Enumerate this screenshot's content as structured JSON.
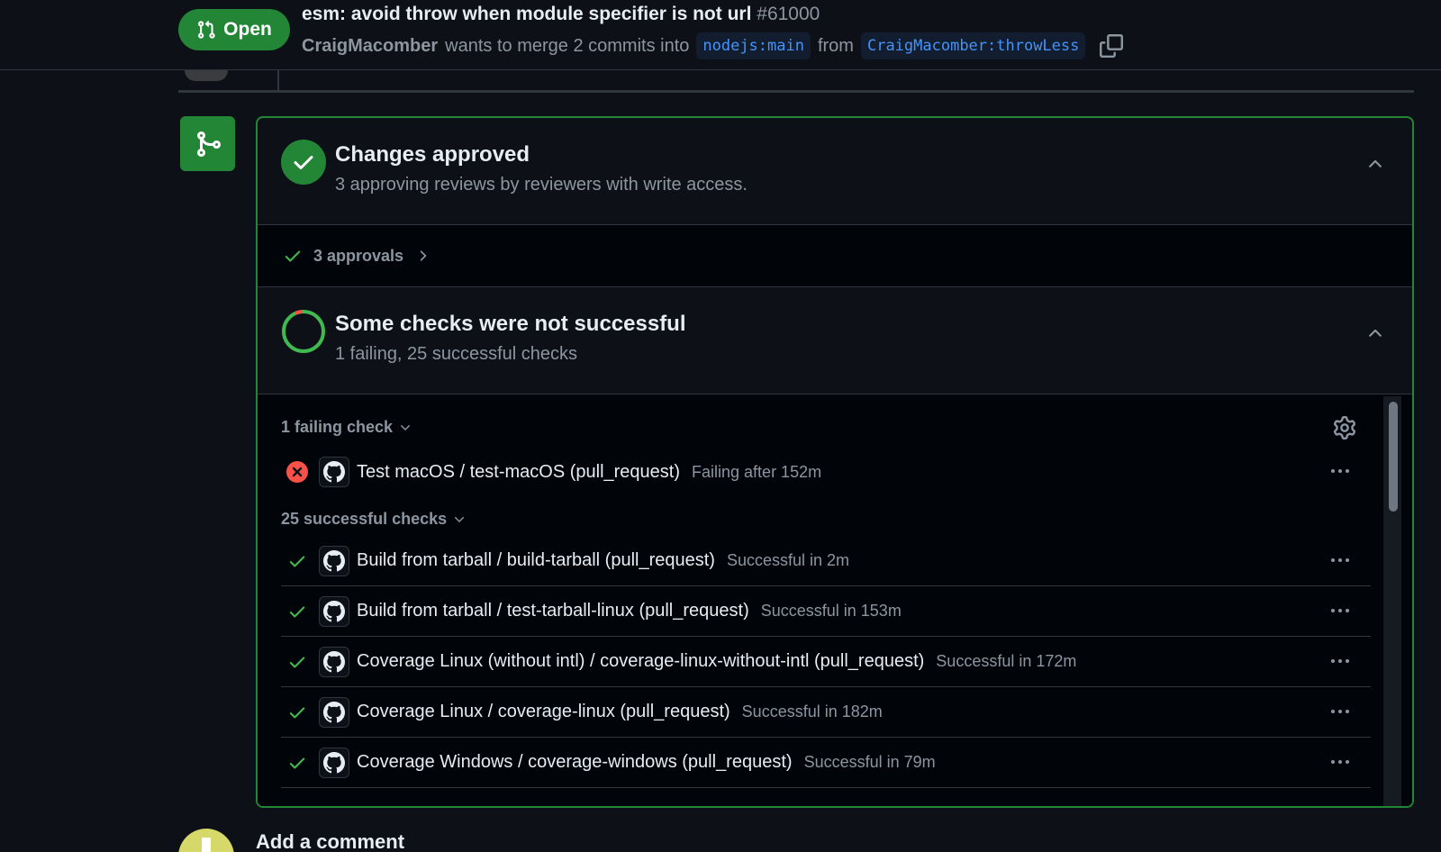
{
  "header": {
    "state_label": "Open",
    "title": "esm: avoid throw when module specifier is not url",
    "number": "#61000",
    "author": "CraigMacomber",
    "merge_text": "wants to merge 2 commits into",
    "base_branch": "nodejs:main",
    "from_text": "from",
    "head_branch": "CraigMacomber:throwLess"
  },
  "approval": {
    "title": "Changes approved",
    "subtitle": "3 approving reviews by reviewers with write access.",
    "approvals_label": "3 approvals"
  },
  "checks": {
    "title": "Some checks were not successful",
    "subtitle": "1 failing, 25 successful checks",
    "failing_group_label": "1 failing check",
    "failing": [
      {
        "name": "Test macOS / test-macOS (pull_request)",
        "status": "Failing after 152m"
      }
    ],
    "successful_group_label": "25 successful checks",
    "successful": [
      {
        "name": "Build from tarball / build-tarball (pull_request)",
        "status": "Successful in 2m"
      },
      {
        "name": "Build from tarball / test-tarball-linux (pull_request)",
        "status": "Successful in 153m"
      },
      {
        "name": "Coverage Linux (without intl) / coverage-linux-without-intl (pull_request)",
        "status": "Successful in 172m"
      },
      {
        "name": "Coverage Linux / coverage-linux (pull_request)",
        "status": "Successful in 182m"
      },
      {
        "name": "Coverage Windows / coverage-windows (pull_request)",
        "status": "Successful in 79m"
      }
    ]
  },
  "comment": {
    "title": "Add a comment"
  },
  "colors": {
    "success": "#238636",
    "success_icon": "#3fb950",
    "danger": "#f85149",
    "link": "#4493f8"
  }
}
